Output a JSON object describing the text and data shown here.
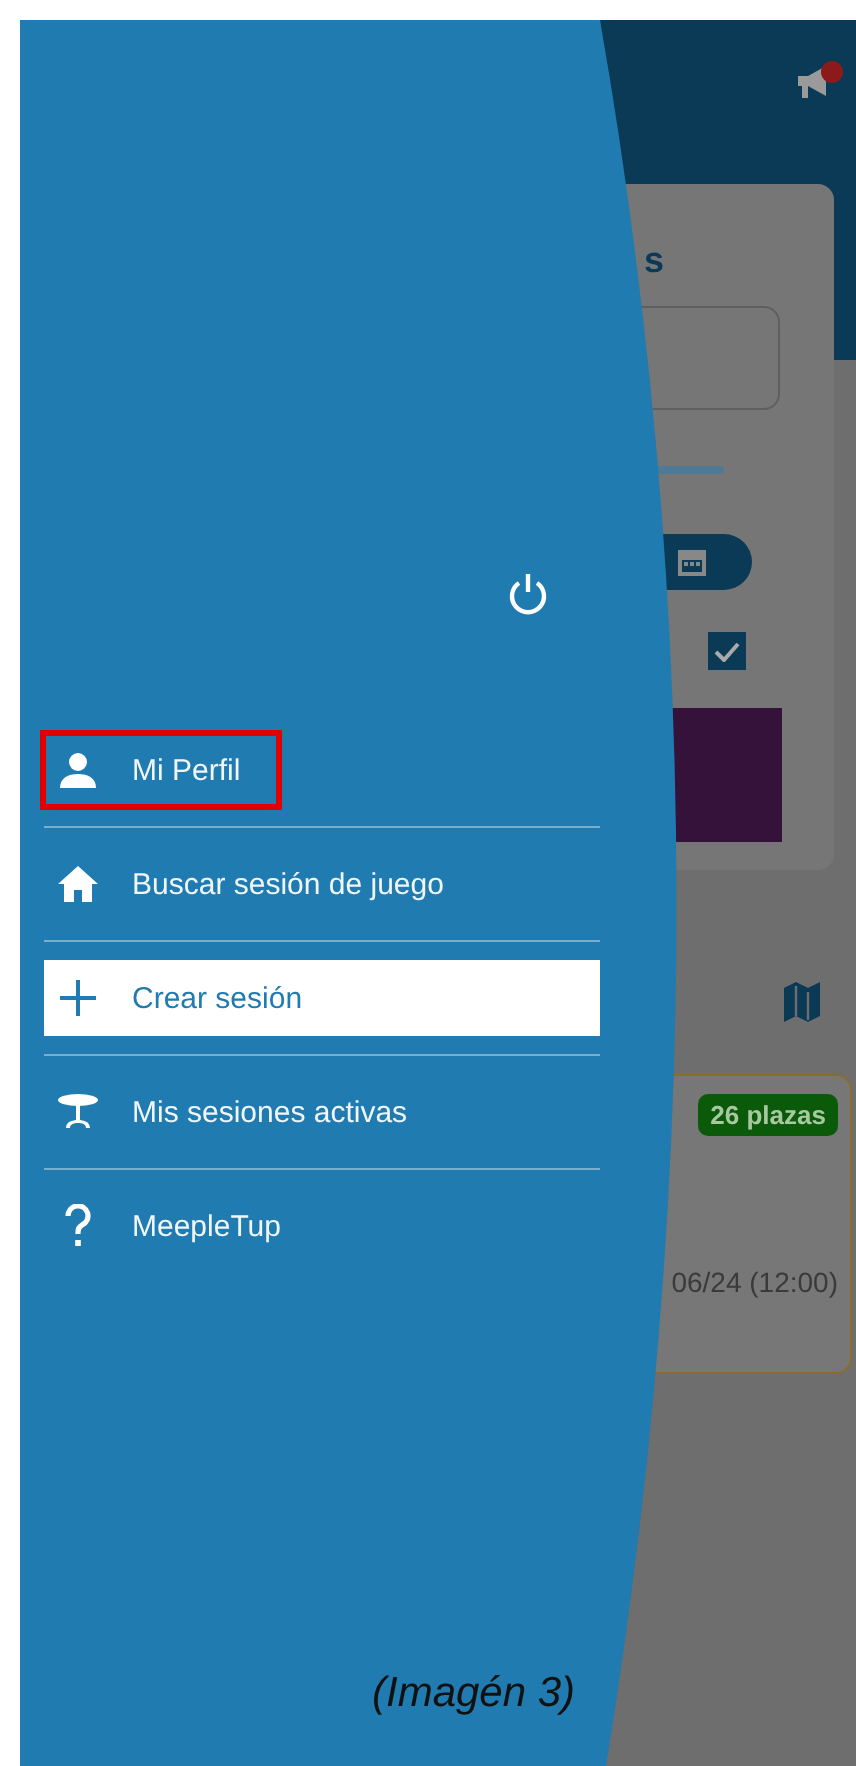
{
  "background": {
    "card_title": "s",
    "badge": "26 plazas",
    "session_date": "06/24 (12:00)",
    "checkbox_checked": true
  },
  "drawer": {
    "items": [
      {
        "kind": "profile",
        "label": "Mi Perfil",
        "selected": false,
        "outlined": true
      },
      {
        "kind": "home",
        "label": "Buscar sesión de juego",
        "selected": false,
        "outlined": false
      },
      {
        "kind": "add",
        "label": "Crear sesión",
        "selected": true,
        "outlined": false
      },
      {
        "kind": "table",
        "label": "Mis sesiones activas",
        "selected": false,
        "outlined": false
      },
      {
        "kind": "help",
        "label": "MeepleTup",
        "selected": false,
        "outlined": false
      }
    ]
  },
  "caption": "(Imagén 3)"
}
